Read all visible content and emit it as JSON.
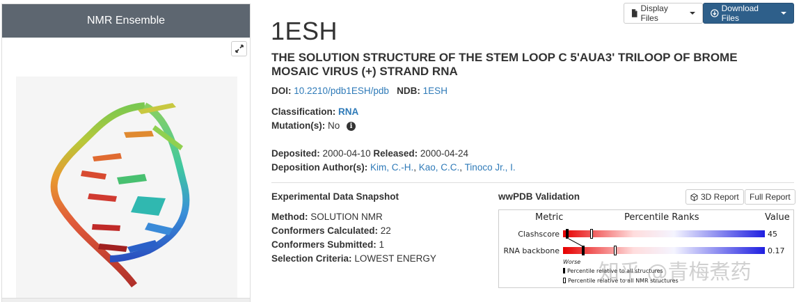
{
  "left_panel": {
    "title": "NMR Ensemble"
  },
  "toolbar": {
    "display_files": "Display Files",
    "download_files": "Download Files"
  },
  "entry": {
    "id": "1ESH",
    "title": "THE SOLUTION STRUCTURE OF THE STEM LOOP C 5'AUA3' TRILOOP OF BROME MOSAIC VIRUS (+) STRAND RNA",
    "doi_label": "DOI:",
    "doi": "10.2210/pdb1ESH/pdb",
    "ndb_label": "NDB:",
    "ndb": "1ESH",
    "classification_label": "Classification:",
    "classification": "RNA",
    "mutation_label": "Mutation(s):",
    "mutation": "No",
    "deposited_label": "Deposited:",
    "deposited": "2000-04-10",
    "released_label": "Released:",
    "released": "2000-04-24",
    "authors_label": "Deposition Author(s):",
    "authors": [
      "Kim, C.-H.",
      "Kao, C.C.",
      "Tinoco Jr., I."
    ]
  },
  "experimental": {
    "heading": "Experimental Data Snapshot",
    "method_label": "Method:",
    "method": "SOLUTION NMR",
    "conformers_calc_label": "Conformers Calculated:",
    "conformers_calc": "22",
    "conformers_sub_label": "Conformers Submitted:",
    "conformers_sub": "1",
    "selection_label": "Selection Criteria:",
    "selection": "LOWEST ENERGY"
  },
  "validation": {
    "heading": "wwPDB Validation",
    "report_3d": "3D Report",
    "full_report": "Full Report",
    "col_metric": "Metric",
    "col_percentile": "Percentile Ranks",
    "col_value": "Value",
    "metrics": [
      {
        "name": "Clashscore",
        "value": "45",
        "all_percentile": 2,
        "nmr_percentile": 14
      },
      {
        "name": "RNA backbone",
        "value": "0.17",
        "all_percentile": 10,
        "nmr_percentile": 26
      }
    ],
    "worse_label": "Worse",
    "legend_all": "Percentile relative to all structures",
    "legend_nmr": "Percentile relative to all NMR structures"
  },
  "watermark": "知乎 @青梅煮药"
}
